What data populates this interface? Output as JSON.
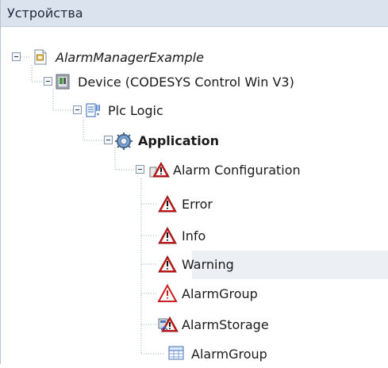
{
  "panel": {
    "title": "Устройства"
  },
  "tree": {
    "project": "AlarmManagerExample",
    "device": "Device (CODESYS Control Win V3)",
    "plc_logic": "Plc Logic",
    "application": "Application",
    "alarm_configuration": "Alarm Configuration",
    "classes": [
      "Error",
      "Info",
      "Warning"
    ],
    "alarm_group": "AlarmGroup",
    "alarm_storage": "AlarmStorage",
    "alarm_group_2": "AlarmGroup"
  },
  "icons": {
    "project": "project-file-icon",
    "device": "device-cabinet-icon",
    "plc_logic": "plc-logic-icon",
    "application": "application-gear-icon",
    "alarm_configuration": "alarm-configuration-icon",
    "alarm_class": "alarm-class-warning-icon",
    "alarm_group": "alarm-group-warning-icon",
    "alarm_storage": "alarm-storage-icon",
    "alarm_group_2": "table-icon"
  },
  "colors": {
    "header_background": "#dbe3ee",
    "selected_row": "#eceff3",
    "alarm_red": "#c91f1f",
    "tree_line": "#9aa5b3"
  }
}
